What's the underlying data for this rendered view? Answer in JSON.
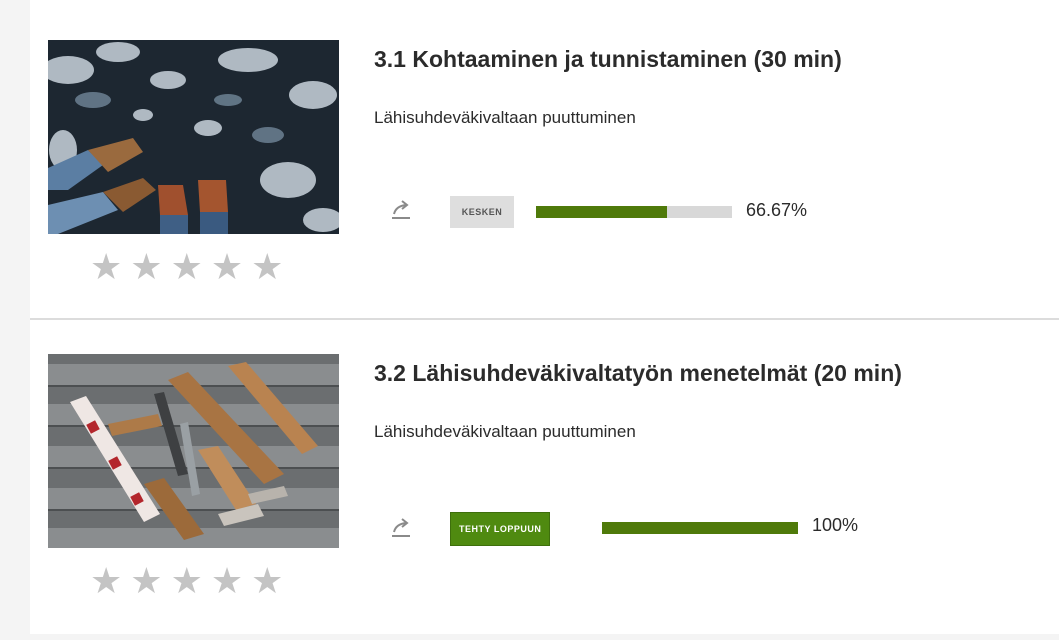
{
  "courses": [
    {
      "title": "3.1 Kohtaaminen ja tunnistaminen (30 min)",
      "subtitle": "Lähisuhdeväkivaltaan puuttuminen",
      "status": "KESKEN",
      "progress_fraction": 0.6667,
      "percent_text": "66.67%",
      "rating": 0,
      "image": "feet-on-frozen-ice-photo"
    },
    {
      "title": "3.2 Lähisuhdeväkivaltatyön menetelmät (20 min)",
      "subtitle": "Lähisuhdeväkivaltaan puuttuminen",
      "status": "TEHTY LOPPUUN",
      "progress_fraction": 1.0,
      "percent_text": "100%",
      "rating": 0,
      "image": "woodworking-tools-on-planks-photo"
    }
  ],
  "icons": {
    "share": "share-icon",
    "star": "star-icon"
  },
  "colors": {
    "progress_fill": "#4f7a0a",
    "done_badge": "#4f8a10",
    "track": "#d8d8d8",
    "star": "#c4c4c4"
  }
}
